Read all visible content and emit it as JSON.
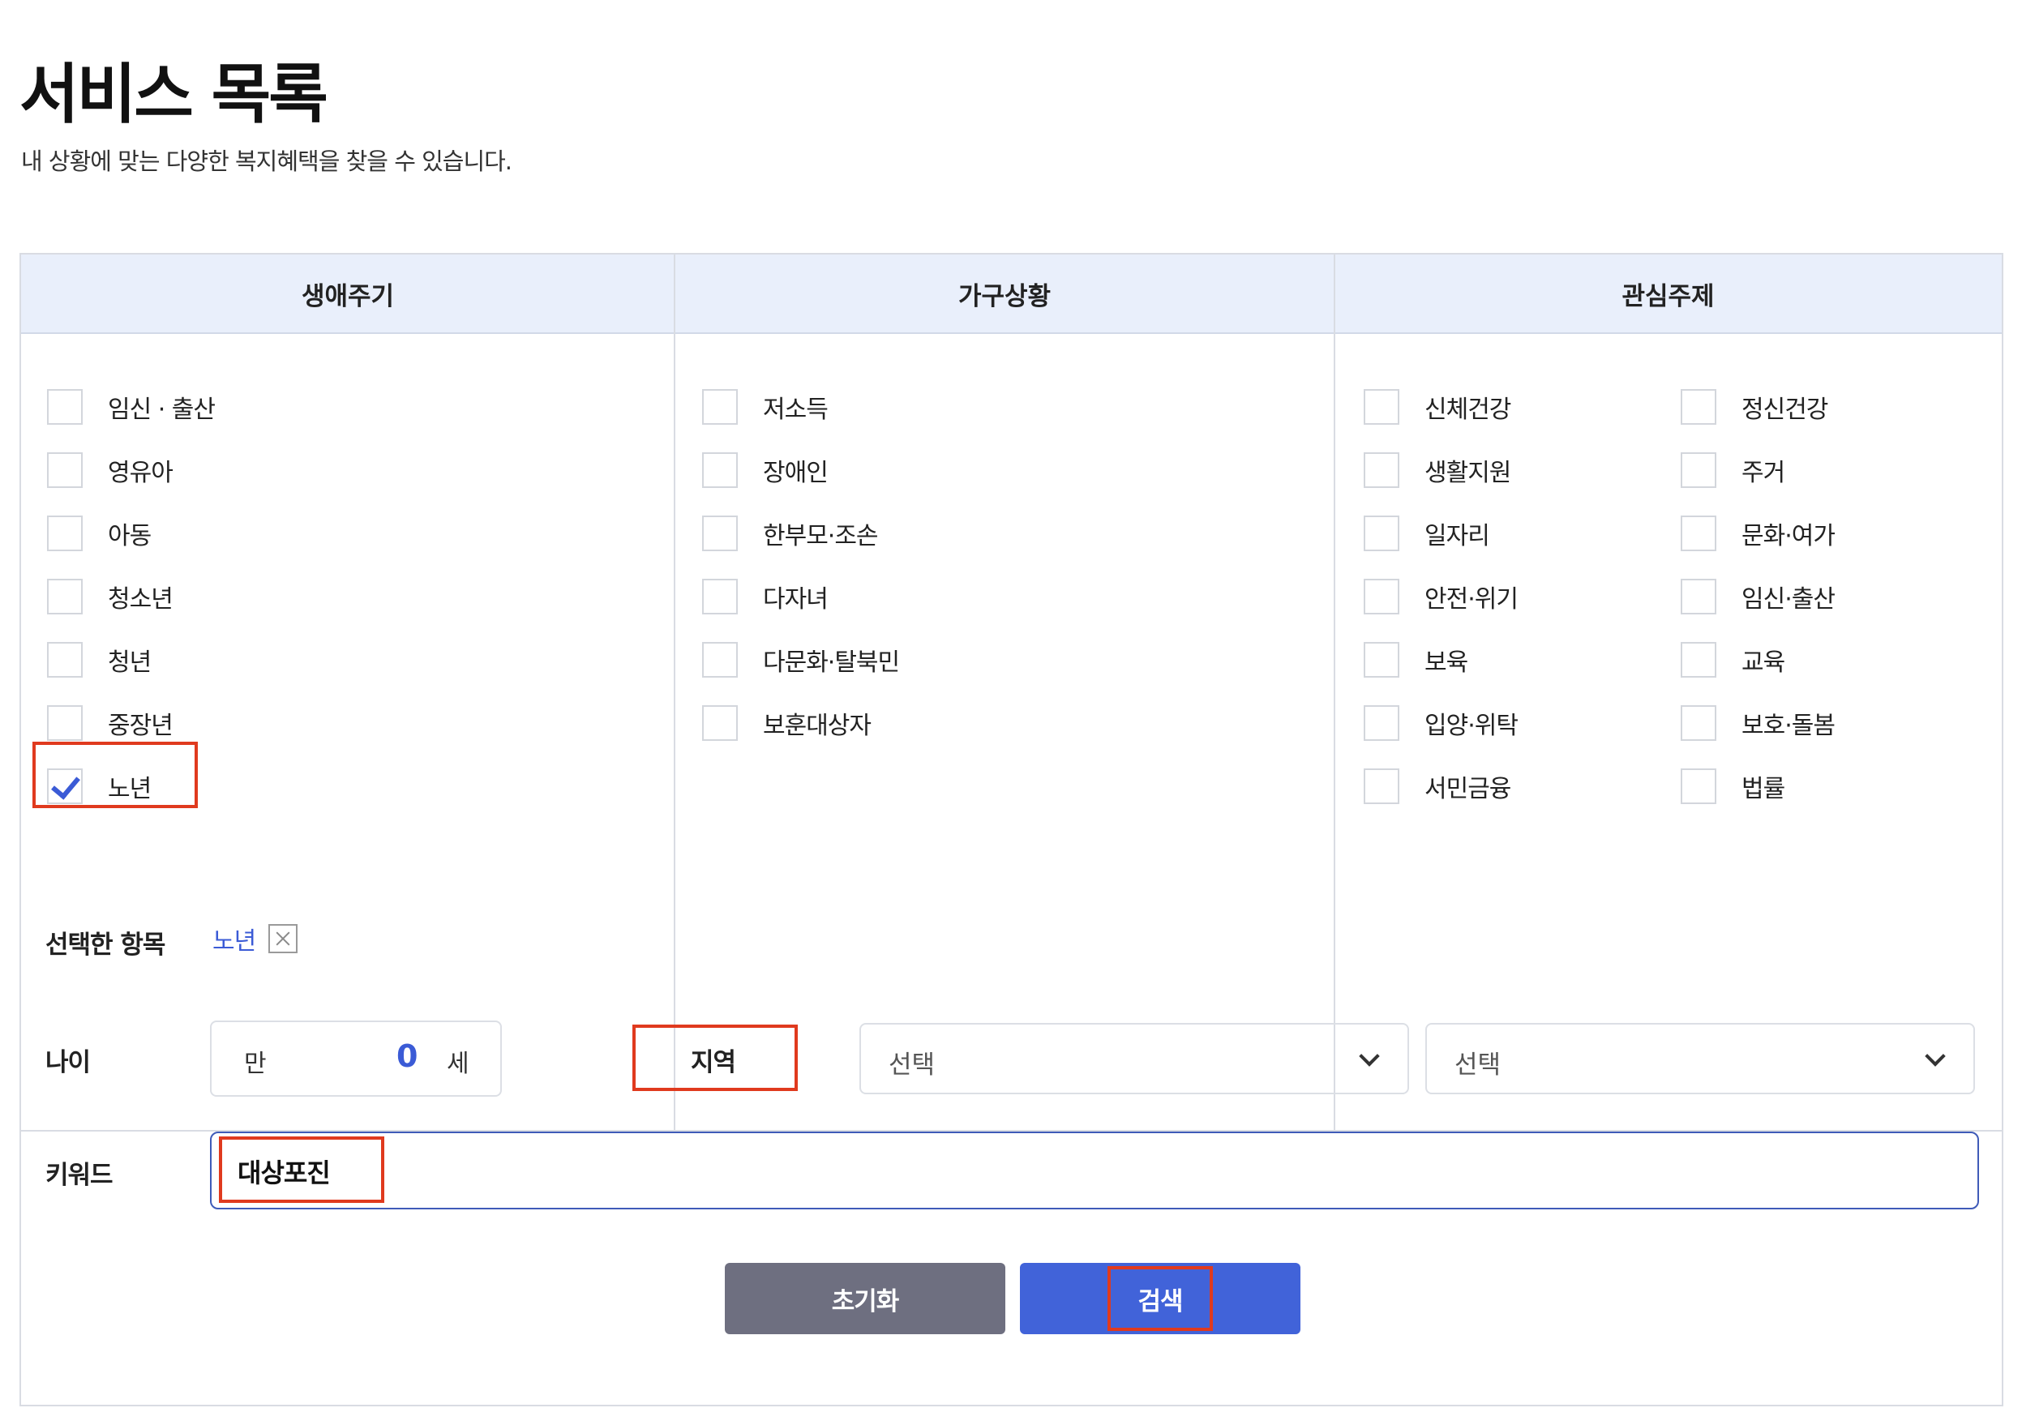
{
  "header": {
    "title": "서비스 목록",
    "description": "내 상황에 맞는 다양한 복지혜택을 찾을 수 있습니다."
  },
  "filters": {
    "lifecycle": {
      "title": "생애주기",
      "items": [
        {
          "label": "임신 · 출산",
          "checked": false
        },
        {
          "label": "영유아",
          "checked": false
        },
        {
          "label": "아동",
          "checked": false
        },
        {
          "label": "청소년",
          "checked": false
        },
        {
          "label": "청년",
          "checked": false
        },
        {
          "label": "중장년",
          "checked": false
        },
        {
          "label": "노년",
          "checked": true
        }
      ]
    },
    "household": {
      "title": "가구상황",
      "items": [
        {
          "label": "저소득",
          "checked": false
        },
        {
          "label": "장애인",
          "checked": false
        },
        {
          "label": "한부모·조손",
          "checked": false
        },
        {
          "label": "다자녀",
          "checked": false
        },
        {
          "label": "다문화·탈북민",
          "checked": false
        },
        {
          "label": "보훈대상자",
          "checked": false
        }
      ]
    },
    "interest": {
      "title": "관심주제",
      "items": [
        {
          "label": "신체건강",
          "checked": false
        },
        {
          "label": "정신건강",
          "checked": false
        },
        {
          "label": "생활지원",
          "checked": false
        },
        {
          "label": "주거",
          "checked": false
        },
        {
          "label": "일자리",
          "checked": false
        },
        {
          "label": "문화·여가",
          "checked": false
        },
        {
          "label": "안전·위기",
          "checked": false
        },
        {
          "label": "임신·출산",
          "checked": false
        },
        {
          "label": "보육",
          "checked": false
        },
        {
          "label": "교육",
          "checked": false
        },
        {
          "label": "입양·위탁",
          "checked": false
        },
        {
          "label": "보호·돌봄",
          "checked": false
        },
        {
          "label": "서민금융",
          "checked": false
        },
        {
          "label": "법률",
          "checked": false
        }
      ]
    }
  },
  "selected": {
    "label": "선택한 항목",
    "chip": "노년"
  },
  "age": {
    "label": "나이",
    "prefix": "만",
    "value": "0",
    "suffix": "세"
  },
  "region": {
    "label": "지역",
    "select1": "선택",
    "select2": "선택"
  },
  "keyword": {
    "label": "키워드",
    "value": "대상포진"
  },
  "buttons": {
    "reset": "초기화",
    "search": "검색"
  },
  "colors": {
    "accent": "#4163d9",
    "reset_button": "#6e6f80",
    "header_bg": "#e9effb",
    "highlight": "#e03a1e"
  }
}
